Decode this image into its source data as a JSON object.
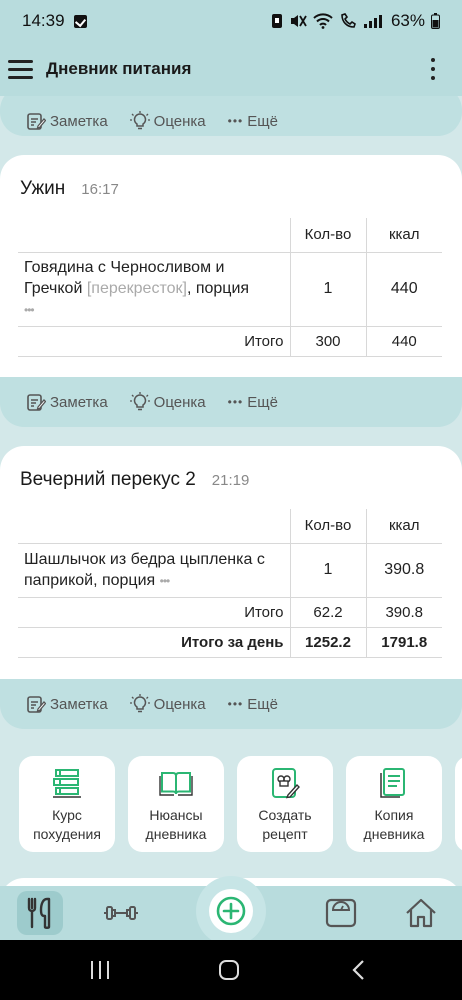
{
  "status_bar": {
    "time": "14:39",
    "battery": "63%"
  },
  "app_bar": {
    "title": "Дневник питания"
  },
  "actions": {
    "note": "Заметка",
    "rating": "Оценка",
    "more": "Ещё"
  },
  "meals": [
    {
      "name": "Ужин",
      "time": "16:17",
      "col_qty": "Кол-во",
      "col_kcal": "ккал",
      "items": [
        {
          "name": "Говядина с Черносливом и Гречкой",
          "brand": "[перекресток]",
          "suffix": ", порция",
          "dots": "•••",
          "qty": "1",
          "kcal": "440"
        }
      ],
      "total_label": "Итого",
      "total_qty": "300",
      "total_kcal": "440"
    },
    {
      "name": "Вечерний перекус 2",
      "time": "21:19",
      "col_qty": "Кол-во",
      "col_kcal": "ккал",
      "items": [
        {
          "name": "Шашлычок из бедра цыпленка с паприкой, порция",
          "dots": "•••",
          "qty": "1",
          "kcal": "390.8"
        }
      ],
      "total_label": "Итого",
      "total_qty": "62.2",
      "total_kcal": "390.8",
      "day_total_label": "Итого за день",
      "day_total_qty": "1252.2",
      "day_total_kcal": "1791.8"
    }
  ],
  "shortcuts": [
    {
      "label1": "Курс",
      "label2": "похудения",
      "icon": "books-icon"
    },
    {
      "label1": "Нюансы",
      "label2": "дневника",
      "icon": "open-book-icon"
    },
    {
      "label1": "Создать",
      "label2": "рецепт",
      "icon": "recipe-icon"
    },
    {
      "label1": "Копия",
      "label2": "дневника",
      "icon": "copy-diary-icon"
    }
  ],
  "bottom_nav": [
    "food-diary-icon",
    "workout-icon",
    "add-icon",
    "scale-icon",
    "home-icon"
  ],
  "colors": {
    "accent": "#2bb673",
    "bar": "#b8dcdd",
    "strip": "#bfe0e1"
  }
}
